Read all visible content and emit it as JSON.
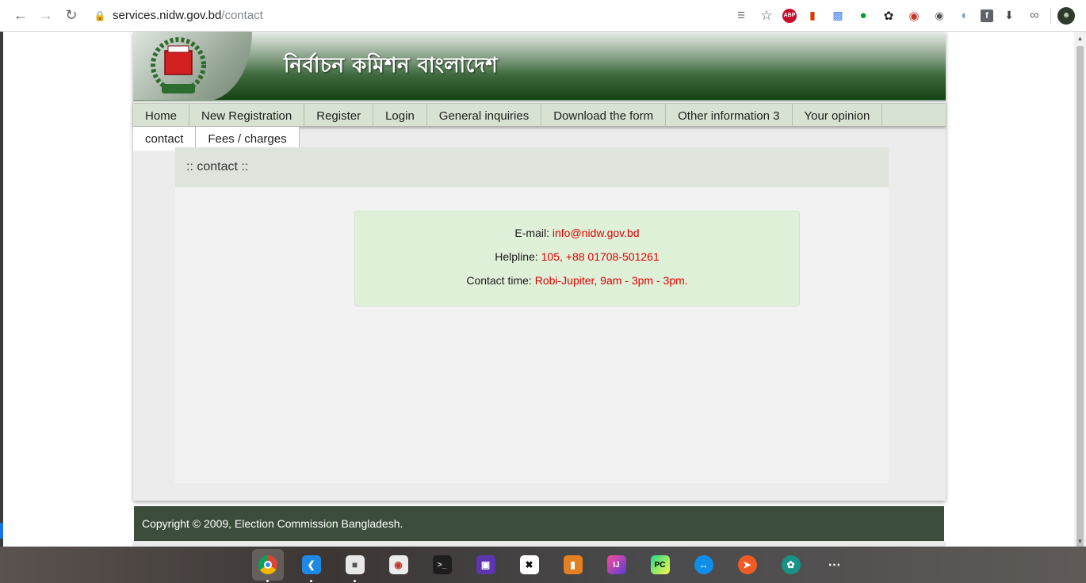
{
  "browser": {
    "url_host": "services.nidw.gov.bd",
    "url_path": "/contact",
    "extensions": [
      "translate-icon",
      "star-icon",
      "adblock-icon",
      "office-icon",
      "google-translate-icon",
      "whatsapp-icon",
      "gnome-icon",
      "color-icon",
      "tampermonkey-icon",
      "feedly-icon",
      "facebook-icon",
      "download-icon",
      "infinity-icon"
    ],
    "abp_label": "ABP"
  },
  "site": {
    "banner_title": "নির্বাচন কমিশন বাংলাদেশ",
    "menu": [
      {
        "label": "Home"
      },
      {
        "label": "New Registration"
      },
      {
        "label": "Register"
      },
      {
        "label": "Login"
      },
      {
        "label": "General inquiries"
      },
      {
        "label": "Download the form"
      },
      {
        "label": "Other information 3"
      },
      {
        "label": "Your opinion"
      }
    ],
    "menu2": [
      {
        "label": "contact"
      },
      {
        "label": "Fees / charges"
      }
    ],
    "section_title": ":: contact ::",
    "contact": {
      "email_label": "E-mail:",
      "email_value": "info@nidw.gov.bd",
      "helpline_label": "Helpline:",
      "helpline_value": "105, +88 01708-501261",
      "time_label": "Contact time:",
      "time_value": "Robi-Jupiter, 9am - 3pm - 3pm."
    },
    "footer": "Copyright © 2009, Election Commission Bangladesh."
  },
  "taskbar": {
    "apps": [
      "chrome",
      "vscode",
      "files",
      "screenshot",
      "terminal",
      "screen-recorder",
      "xpad",
      "sublime-merge",
      "intellij",
      "pycharm",
      "teamviewer",
      "postman",
      "gitkraken",
      "app-grid"
    ]
  },
  "colors": {
    "banner_dark": "#123f12",
    "menu_bg": "#d8e2d2",
    "footer_bg": "#3c4d3c",
    "contact_box_bg": "#dff0d8",
    "link_red": "#e00000"
  }
}
